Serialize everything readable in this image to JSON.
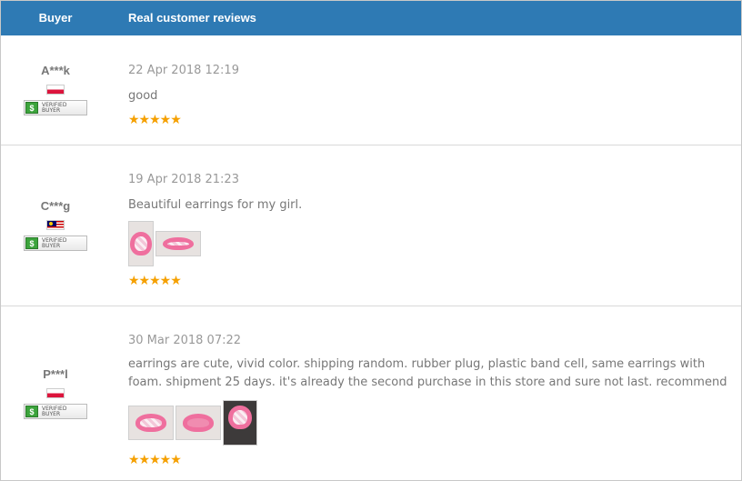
{
  "header": {
    "buyer": "Buyer",
    "reviews": "Real customer reviews"
  },
  "badge": {
    "icon": "dollar-shield-icon",
    "line1": "VERIFIED",
    "line2": "BUYER"
  },
  "reviews": [
    {
      "buyer": "A***k",
      "country_flag": "flag-poland-icon",
      "date": "22 Apr 2018 12:19",
      "text": "good",
      "rating": 5,
      "stars": "★★★★★",
      "photos": 0
    },
    {
      "buyer": "C***g",
      "country_flag": "flag-malaysia-icon",
      "date": "19 Apr 2018 21:23",
      "text": "Beautiful earrings for my girl.",
      "rating": 5,
      "stars": "★★★★★",
      "photos": 2
    },
    {
      "buyer": "P***l",
      "country_flag": "flag-poland-icon",
      "date": "30 Mar 2018 07:22",
      "text": "earrings are cute, vivid color. shipping random. rubber plug, plastic band cell, same earrings with foam. shipment 25 days. it's already the second purchase in this store and sure not last. recommend",
      "rating": 5,
      "stars": "★★★★★",
      "photos": 3
    }
  ]
}
